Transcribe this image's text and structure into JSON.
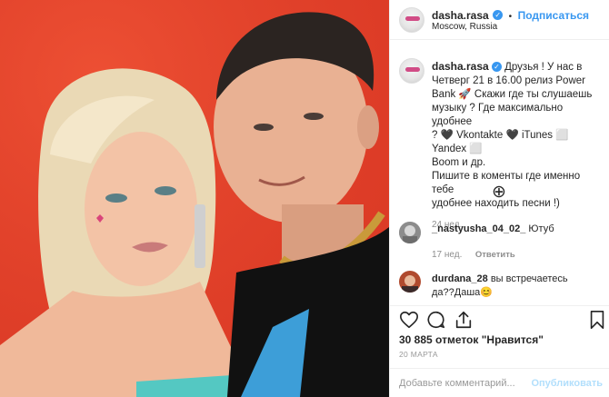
{
  "post": {
    "photo_alt": "",
    "account": {
      "username": "dasha.rasa",
      "verified_glyph": "✓",
      "separator": "•",
      "follow_label": "Подписаться",
      "location": "Moscow, Russia"
    },
    "caption": {
      "username": "dasha.rasa",
      "lines": [
        "Друзья ! У нас в",
        "Четверг 21 в 16.00 релиз Power",
        "Bank 🚀 Скажи где ты слушаешь",
        "музыку ? Где максимально удобнее",
        "? 🖤 Vkontakte 🖤 iTunes ⬜ Yandex ⬜",
        "Boom и др.",
        "Пишите в коменты где именно тебе",
        "удобнее находить песни !)"
      ],
      "age": "24 нед."
    },
    "load_more_glyph": "⊕",
    "comments": [
      {
        "username": "_nastyusha_04_02_",
        "text": "Ютуб",
        "age": "17 нед.",
        "reply_label": "Ответить"
      },
      {
        "username": "durdana_28",
        "text_line1": "вы встречаетесь",
        "text_line2": "да??Даша😊"
      }
    ],
    "likes": "30 885 отметок \"Нравится\"",
    "date": "20 МАРТА",
    "add_comment_placeholder": "Добавьте комментарий...",
    "publish_label": "Опубликовать"
  },
  "icons": {
    "like": "heart-icon",
    "comment": "comment-icon",
    "share": "share-icon",
    "save": "bookmark-icon",
    "more": "plus-circle-icon"
  },
  "colors": {
    "photo_background": "#e8402a",
    "link_blue": "#3897f0",
    "secondary_text": "#8e8e8e",
    "divider": "#efefef"
  }
}
